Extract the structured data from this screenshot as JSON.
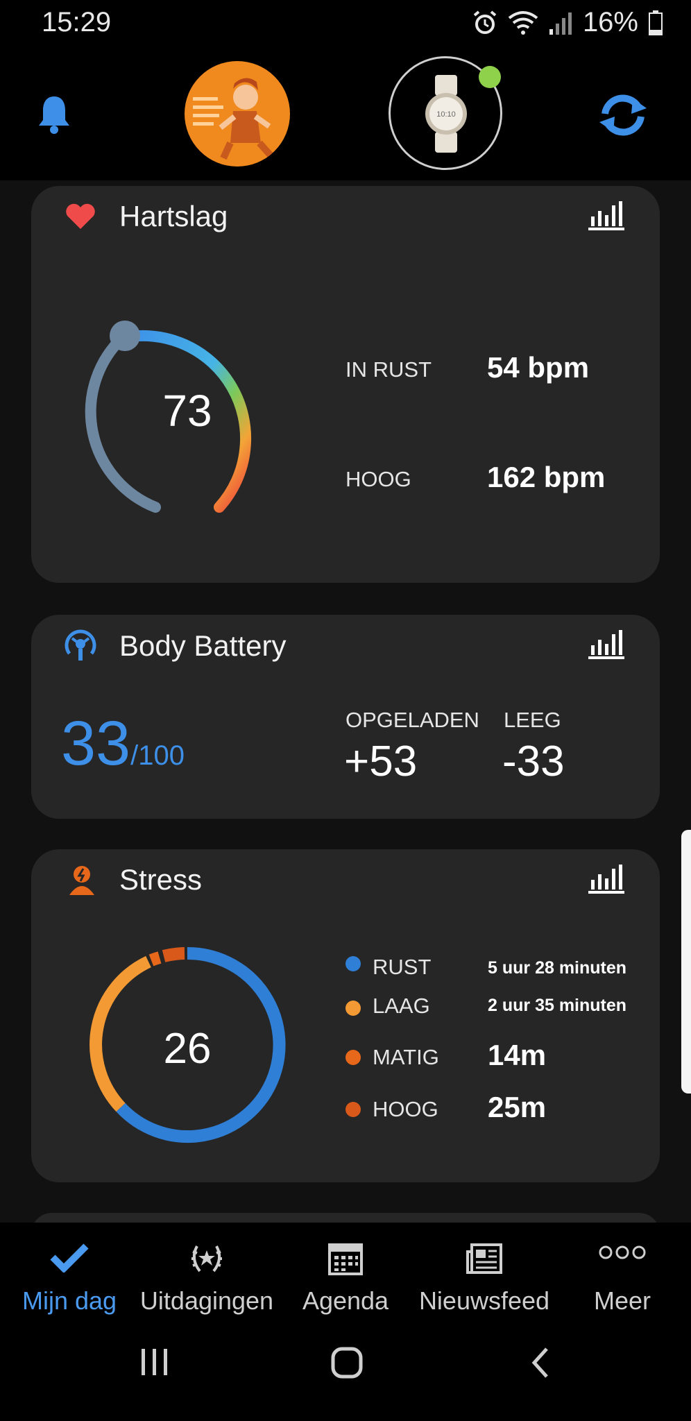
{
  "status": {
    "time": "15:29",
    "battery": "16%"
  },
  "heart": {
    "title": "Hartslag",
    "current": "73",
    "rest_label": "IN RUST",
    "rest_value": "54 bpm",
    "high_label": "HOOG",
    "high_value": "162 bpm"
  },
  "battery": {
    "title": "Body Battery",
    "value": "33",
    "max": "/100",
    "charged_label": "OPGELADEN",
    "charged_value": "+53",
    "drained_label": "LEEG",
    "drained_value": "-33"
  },
  "stress": {
    "title": "Stress",
    "value": "26",
    "items": [
      {
        "label": "RUST",
        "value": "5 uur 28 minuten",
        "color": "#2f7fd6"
      },
      {
        "label": "LAAG",
        "value": "2 uur 35 minuten",
        "color": "#f39a34"
      },
      {
        "label": "MATIG",
        "value": "14m",
        "color": "#e8681b"
      },
      {
        "label": "HOOG",
        "value": "25m",
        "color": "#d9591a"
      }
    ]
  },
  "nav": {
    "items": [
      {
        "label": "Mijn dag",
        "icon": "check-icon"
      },
      {
        "label": "Uitdagingen",
        "icon": "laurel-icon"
      },
      {
        "label": "Agenda",
        "icon": "calendar-icon"
      },
      {
        "label": "Nieuwsfeed",
        "icon": "news-icon"
      },
      {
        "label": "Meer",
        "icon": "more-icon"
      }
    ]
  },
  "colors": {
    "accent": "#3d8fe8",
    "active_nav": "#4a9af0",
    "card": "#262626"
  }
}
